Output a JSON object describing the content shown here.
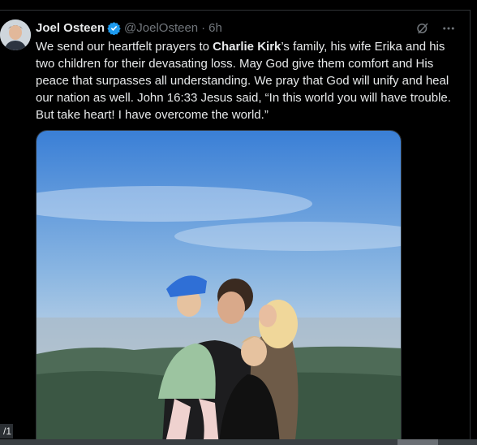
{
  "author": {
    "name": "Joel Osteen",
    "handle": "@JoelOsteen",
    "separator": "·",
    "time": "6h"
  },
  "tweet": {
    "text_1": "We send our heartfelt prayers to ",
    "bold_1": "Charlie Kirk",
    "text_2": "’s family, his wife Erika and his two children for their devasating loss. May God give them comfort and His peace that surpasses all understanding.  We pray that God will unify and heal our nation as well.  John 16:33 Jesus said, “In this world you will have trouble. But take heart! I have overcome the world.”"
  },
  "page_indicator": "/1",
  "icons": {
    "verified": "verified-badge-icon",
    "grok": "grok-icon",
    "more": "more-options-icon"
  },
  "colors": {
    "background": "#000000",
    "text": "#e7e9ea",
    "muted": "#71767b",
    "verified": "#1d9bf0"
  }
}
